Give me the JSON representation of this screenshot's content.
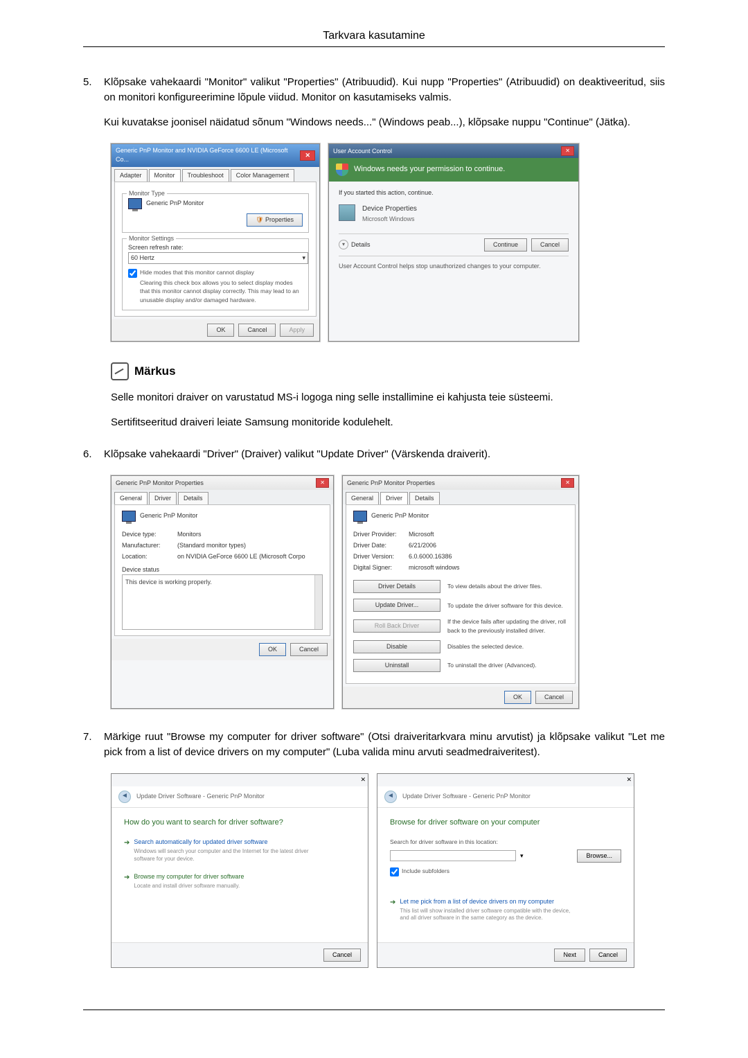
{
  "page_title": "Tarkvara kasutamine",
  "step5": {
    "num": "5.",
    "text": "Klõpsake vahekaardi \"Monitor\" valikut \"Properties\" (Atribuudid). Kui nupp \"Properties\" (Atribuudid) on deaktiveeritud, siis on monitori konfigureerimine lõpule viidud. Monitor on kasutamiseks valmis.",
    "text2": "Kui kuvatakse joonisel näidatud sõnum \"Windows needs...\" (Windows peab...), klõpsake nuppu \"Continue\" (Jätka)."
  },
  "note": {
    "label": "Märkus",
    "p1": "Selle monitori draiver on varustatud MS-i logoga ning selle installimine ei kahjusta teie süsteemi.",
    "p2": "Sertifitseeritud draiveri leiate Samsung monitoride kodulehelt."
  },
  "step6": {
    "num": "6.",
    "text": "Klõpsake vahekaardi \"Driver\" (Draiver) valikut \"Update Driver\" (Värskenda draiverit)."
  },
  "step7": {
    "num": "7.",
    "text": "Märkige ruut \"Browse my computer for driver software\" (Otsi draiveritarkvara minu arvutist) ja klõpsake valikut \"Let me pick from a list of device drivers on my computer\" (Luba valida minu arvuti seadmedraiveritest)."
  },
  "monwin": {
    "title": "Generic PnP Monitor and NVIDIA GeForce 6600 LE (Microsoft Co...",
    "tabs": {
      "adapter": "Adapter",
      "monitor": "Monitor",
      "trouble": "Troubleshoot",
      "color": "Color Management"
    },
    "monitor_type_label": "Monitor Type",
    "monitor_name": "Generic PnP Monitor",
    "properties_btn": "Properties",
    "settings_label": "Monitor Settings",
    "refresh_label": "Screen refresh rate:",
    "refresh_value": "60 Hertz",
    "hide_modes": "Hide modes that this monitor cannot display",
    "hide_desc": "Clearing this check box allows you to select display modes that this monitor cannot display correctly. This may lead to an unusable display and/or damaged hardware.",
    "ok": "OK",
    "cancel": "Cancel",
    "apply": "Apply"
  },
  "uac": {
    "title": "User Account Control",
    "headline": "Windows needs your permission to continue.",
    "started": "If you started this action, continue.",
    "app_name": "Device Properties",
    "app_pub": "Microsoft Windows",
    "details": "Details",
    "continue": "Continue",
    "cancel": "Cancel",
    "footnote": "User Account Control helps stop unauthorized changes to your computer."
  },
  "propGeneral": {
    "title": "Generic PnP Monitor Properties",
    "tabs": {
      "general": "General",
      "driver": "Driver",
      "details": "Details"
    },
    "name": "Generic PnP Monitor",
    "k_type": "Device type:",
    "v_type": "Monitors",
    "k_mfr": "Manufacturer:",
    "v_mfr": "(Standard monitor types)",
    "k_loc": "Location:",
    "v_loc": "on NVIDIA GeForce 6600 LE (Microsoft Corpo",
    "status_label": "Device status",
    "status_text": "This device is working properly.",
    "ok": "OK",
    "cancel": "Cancel"
  },
  "propDriver": {
    "title": "Generic PnP Monitor Properties",
    "name": "Generic PnP Monitor",
    "k_provider": "Driver Provider:",
    "v_provider": "Microsoft",
    "k_date": "Driver Date:",
    "v_date": "6/21/2006",
    "k_version": "Driver Version:",
    "v_version": "6.0.6000.16386",
    "k_signer": "Digital Signer:",
    "v_signer": "microsoft windows",
    "btn_details": "Driver Details",
    "d_details": "To view details about the driver files.",
    "btn_update": "Update Driver...",
    "d_update": "To update the driver software for this device.",
    "btn_rollback": "Roll Back Driver",
    "d_rollback": "If the device fails after updating the driver, roll back to the previously installed driver.",
    "btn_disable": "Disable",
    "d_disable": "Disables the selected device.",
    "btn_uninstall": "Uninstall",
    "d_uninstall": "To uninstall the driver (Advanced).",
    "ok": "OK",
    "cancel": "Cancel"
  },
  "wiz1": {
    "breadcrumb": "Update Driver Software - Generic PnP Monitor",
    "heading": "How do you want to search for driver software?",
    "opt1_t": "Search automatically for updated driver software",
    "opt1_s": "Windows will search your computer and the Internet for the latest driver software for your device.",
    "opt2_t": "Browse my computer for driver software",
    "opt2_s": "Locate and install driver software manually.",
    "cancel": "Cancel"
  },
  "wiz2": {
    "breadcrumb": "Update Driver Software - Generic PnP Monitor",
    "heading": "Browse for driver software on your computer",
    "loc_label": "Search for driver software in this location:",
    "browse": "Browse...",
    "include_sub": "Include subfolders",
    "opt_t": "Let me pick from a list of device drivers on my computer",
    "opt_s": "This list will show installed driver software compatible with the device, and all driver software in the same category as the device.",
    "next": "Next",
    "cancel": "Cancel"
  }
}
